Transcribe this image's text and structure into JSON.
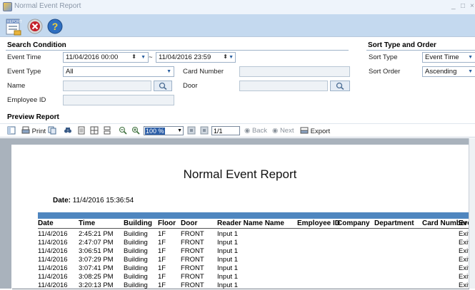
{
  "window": {
    "title": "Normal Event Report",
    "controls": [
      "_",
      "□",
      "×"
    ]
  },
  "toolbar": {
    "buttons": [
      {
        "name": "report-icon",
        "label": "REPORT"
      },
      {
        "name": "close-icon",
        "label": ""
      },
      {
        "name": "help-icon",
        "label": ""
      }
    ]
  },
  "search": {
    "title": "Search Condition",
    "event_time_label": "Event Time",
    "from_time": "11/04/2016 00:00",
    "tilde": "~",
    "to_time": "11/04/2016 23:59",
    "event_type_label": "Event Type",
    "event_type_value": "All",
    "card_number_label": "Card Number",
    "card_number_value": "",
    "name_label": "Name",
    "name_value": "",
    "door_label": "Door",
    "door_value": "",
    "employee_id_label": "Employee ID",
    "employee_id_value": ""
  },
  "sort": {
    "title": "Sort Type and Order",
    "type_label": "Sort Type",
    "type_value": "Event Time",
    "order_label": "Sort Order",
    "order_value": "Ascending"
  },
  "preview": {
    "title": "Preview Report",
    "print": "Print",
    "zoom": "100 %",
    "page": "1/1",
    "back": "Back",
    "next": "Next",
    "export": "Export"
  },
  "report": {
    "title": "Normal Event Report",
    "date_label": "Date:",
    "date_value": "11/4/2016 15:36:54",
    "columns": [
      "Date",
      "Time",
      "Building",
      "Floor",
      "Door",
      "Reader Name Name",
      "Employee ID",
      "Company",
      "Department",
      "Card Number",
      "Eve"
    ],
    "rows": [
      [
        "11/4/2016",
        "2:45:21 PM",
        "Building",
        "1F",
        "FRONT",
        "Input 1",
        "",
        "",
        "",
        "",
        "Exit"
      ],
      [
        "11/4/2016",
        "2:47:07 PM",
        "Building",
        "1F",
        "FRONT",
        "Input 1",
        "",
        "",
        "",
        "",
        "Exit"
      ],
      [
        "11/4/2016",
        "3:06:51 PM",
        "Building",
        "1F",
        "FRONT",
        "Input 1",
        "",
        "",
        "",
        "",
        "Exit"
      ],
      [
        "11/4/2016",
        "3:07:29 PM",
        "Building",
        "1F",
        "FRONT",
        "Input 1",
        "",
        "",
        "",
        "",
        "Exit"
      ],
      [
        "11/4/2016",
        "3:07:41 PM",
        "Building",
        "1F",
        "FRONT",
        "Input 1",
        "",
        "",
        "",
        "",
        "Exit"
      ],
      [
        "11/4/2016",
        "3:08:25 PM",
        "Building",
        "1F",
        "FRONT",
        "Input 1",
        "",
        "",
        "",
        "",
        "Exit"
      ],
      [
        "11/4/2016",
        "3:20:13 PM",
        "Building",
        "1F",
        "FRONT",
        "Input 1",
        "",
        "",
        "",
        "",
        "Exit"
      ]
    ]
  }
}
